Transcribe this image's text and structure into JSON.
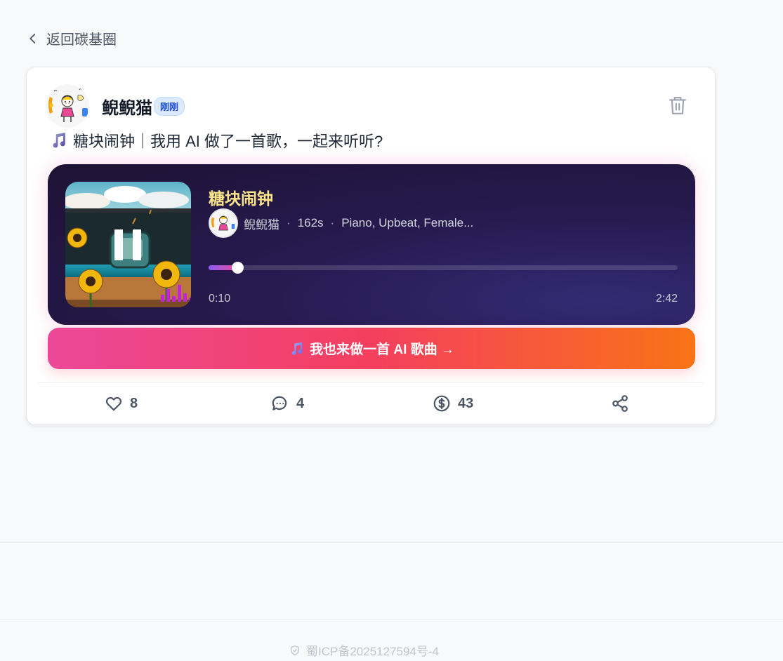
{
  "nav": {
    "back_label": "返回碳基圈"
  },
  "post": {
    "author": "鲵鲵猫",
    "time_badge": "刚刚",
    "text": "糖块闹钟｜我用 AI 做了一首歌，一起来听听?",
    "icons": {
      "note": "music-note-icon",
      "delete": "trash-icon"
    }
  },
  "player": {
    "song_title": "糖块闹钟",
    "artist": "鲵鲵猫",
    "duration_label": "162s",
    "tags": "Piano, Upbeat, Female...",
    "current_time": "0:10",
    "total_time": "2:42",
    "progress_fraction": 0.062,
    "state": "playing"
  },
  "cta": {
    "label": "我也来做一首 AI 歌曲 →"
  },
  "actions": {
    "likes": "8",
    "comments": "4",
    "coins": "43"
  },
  "footer": {
    "icp": "蜀ICP备2025127594号-4"
  },
  "colors": {
    "page_bg": "#f8f9fb",
    "title_gold": "#fde68a",
    "cta_start": "#ec4899",
    "cta_end": "#f97316",
    "badge_blue": "#1d4ed8"
  }
}
